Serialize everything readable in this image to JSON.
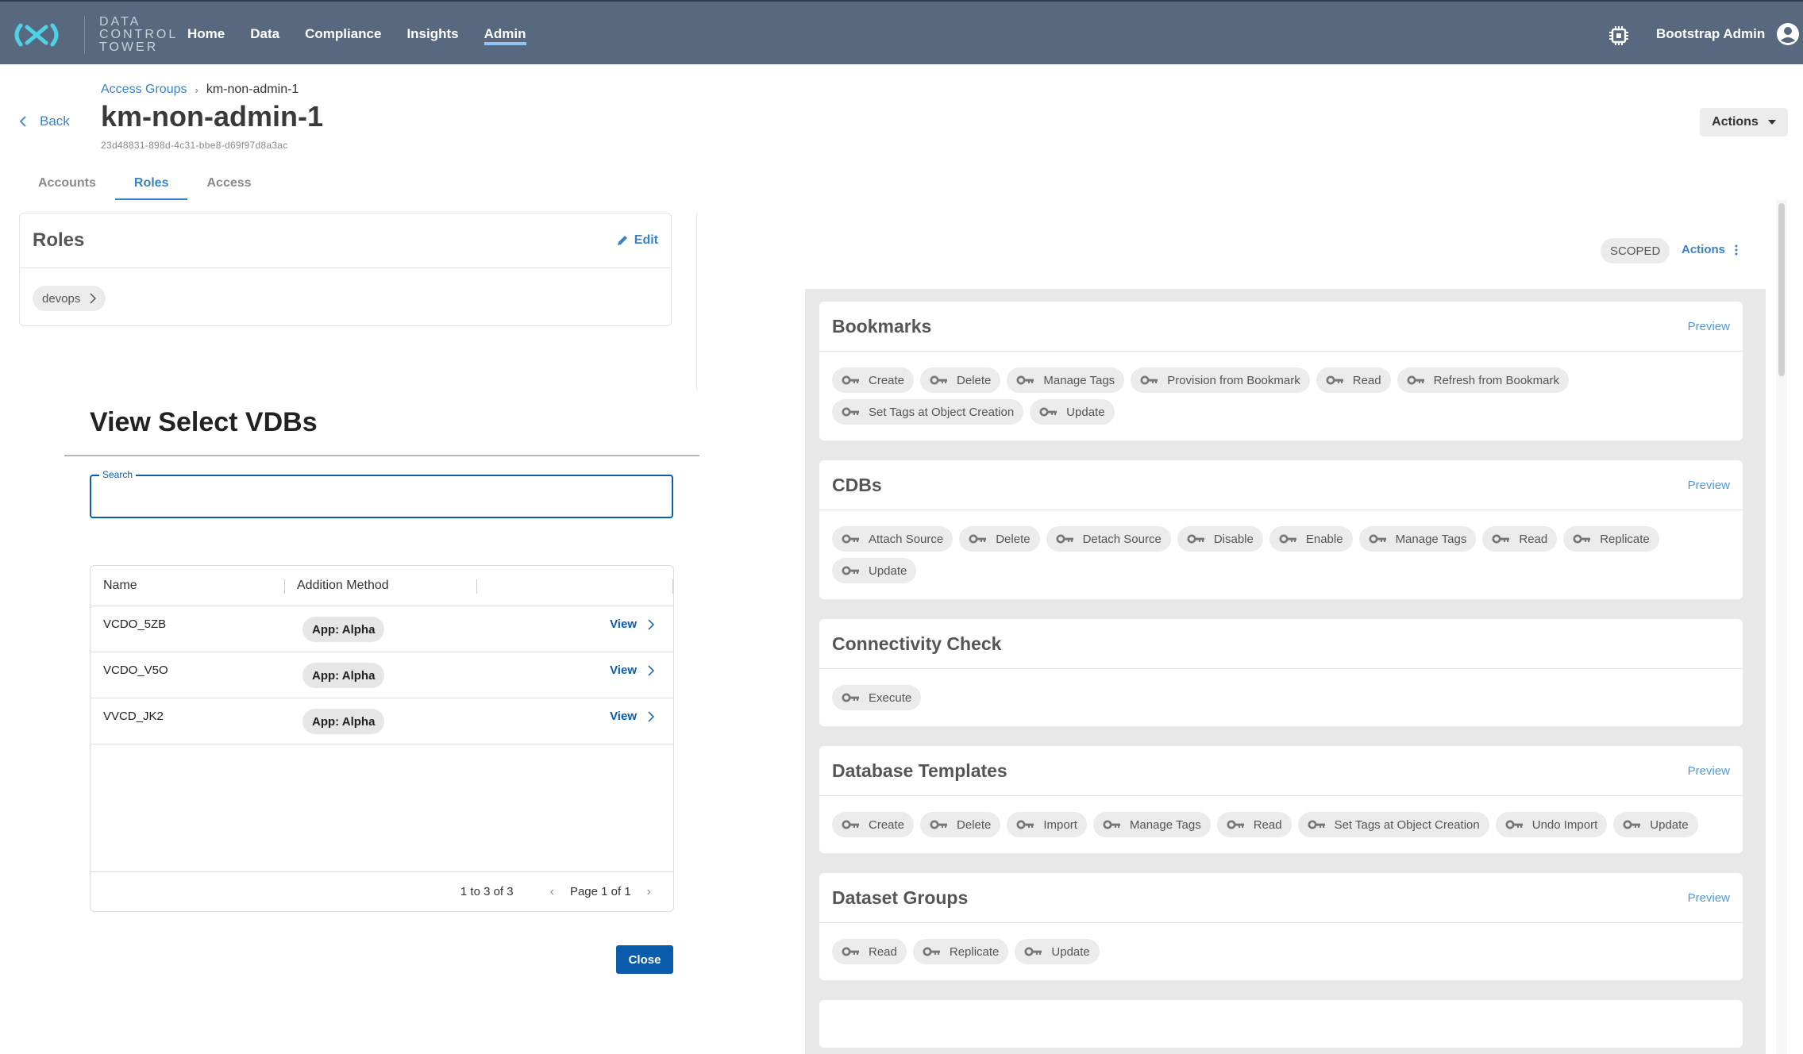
{
  "header": {
    "brand_lines": [
      "DATA",
      "CONTROL",
      "TOWER"
    ],
    "nav": [
      {
        "label": "Home",
        "active": false
      },
      {
        "label": "Data",
        "active": false
      },
      {
        "label": "Compliance",
        "active": false
      },
      {
        "label": "Insights",
        "active": false
      },
      {
        "label": "Admin",
        "active": true
      }
    ],
    "user_name": "Bootstrap Admin",
    "icons": {
      "settings": "chip-icon",
      "user": "account-circle-icon"
    },
    "colors": {
      "bar": "#58697f",
      "logo": "#4fd1e8",
      "active_underline": "#8ec4ef"
    }
  },
  "page": {
    "back_label": "Back",
    "breadcrumb": {
      "parent": "Access Groups",
      "current": "km-non-admin-1"
    },
    "title": "km-non-admin-1",
    "id": "23d48831-898d-4c31-bbe8-d69f97d8a3ac",
    "actions_label": "Actions",
    "tabs": [
      {
        "label": "Accounts",
        "active": false
      },
      {
        "label": "Roles",
        "active": true
      },
      {
        "label": "Access",
        "active": false
      }
    ]
  },
  "roles_card": {
    "title": "Roles",
    "edit_label": "Edit",
    "roles": [
      "devops"
    ]
  },
  "modal": {
    "title": "View Select VDBs",
    "search_label": "Search",
    "search_value": "",
    "columns": [
      "Name",
      "Addition Method"
    ],
    "rows": [
      {
        "name": "VCDO_5ZB",
        "method": "App: Alpha",
        "action": "View"
      },
      {
        "name": "VCDO_V5O",
        "method": "App: Alpha",
        "action": "View"
      },
      {
        "name": "VVCD_JK2",
        "method": "App: Alpha",
        "action": "View"
      }
    ],
    "range_text": "1 to 3 of 3",
    "page_text": "Page 1 of 1",
    "close_label": "Close",
    "colors": {
      "primary": "#0b5cad"
    }
  },
  "right_panel": {
    "scope_badge": "SCOPED",
    "actions_label": "Actions",
    "preview_label": "Preview",
    "sections": [
      {
        "title": "Bookmarks",
        "has_preview": true,
        "permissions": [
          "Create",
          "Delete",
          "Manage Tags",
          "Provision from Bookmark",
          "Read",
          "Refresh from Bookmark",
          "Set Tags at Object Creation",
          "Update"
        ]
      },
      {
        "title": "CDBs",
        "has_preview": true,
        "permissions": [
          "Attach Source",
          "Delete",
          "Detach Source",
          "Disable",
          "Enable",
          "Manage Tags",
          "Read",
          "Replicate",
          "Update"
        ]
      },
      {
        "title": "Connectivity Check",
        "has_preview": false,
        "permissions": [
          "Execute"
        ]
      },
      {
        "title": "Database Templates",
        "has_preview": true,
        "permissions": [
          "Create",
          "Delete",
          "Import",
          "Manage Tags",
          "Read",
          "Set Tags at Object Creation",
          "Undo Import",
          "Update"
        ]
      },
      {
        "title": "Dataset Groups",
        "has_preview": true,
        "permissions": [
          "Read",
          "Replicate",
          "Update"
        ]
      }
    ]
  }
}
